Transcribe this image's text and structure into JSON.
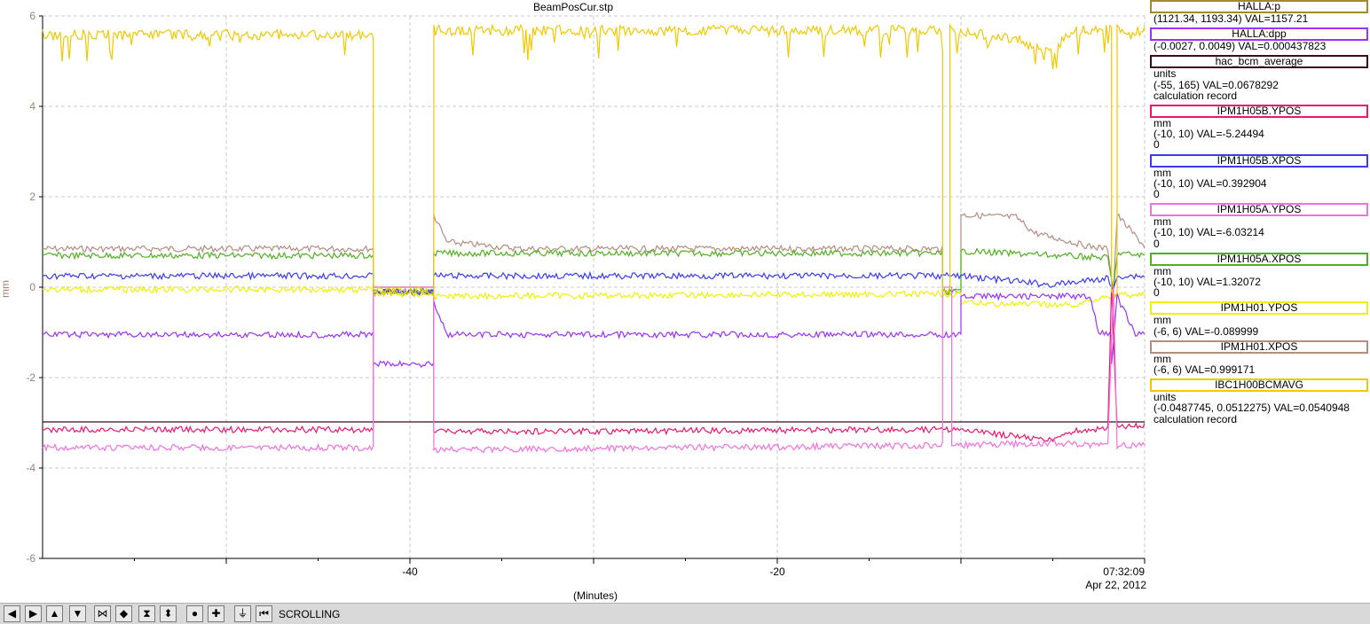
{
  "window": {
    "title": "BeamPosCur.stp"
  },
  "axis": {
    "ylabel": "mm",
    "xlabel": "(Minutes)",
    "timestamp_time": "07:32:09",
    "timestamp_date": "Apr 22, 2012",
    "y_ticks": [
      "6",
      "4",
      "2",
      "0",
      "-2",
      "-4",
      "-6"
    ],
    "x_ticks": [
      "-40",
      "-20"
    ]
  },
  "legend": [
    {
      "name": "HALLA:p",
      "color": "#a08c28",
      "lines": [
        "(1121.34, 1193.34) VAL=1157.21"
      ]
    },
    {
      "name": "HALLA:dpp",
      "color": "#9b30ff",
      "lines": [
        "(-0.0027, 0.0049) VAL=0.000437823"
      ]
    },
    {
      "name": "hac_bcm_average",
      "color": "#3a0a1e",
      "lines": [
        "units",
        "(-55, 165) VAL=0.0678292",
        "calculation record"
      ]
    },
    {
      "name": "IPM1H05B.YPOS",
      "color": "#e8186e",
      "lines": [
        "mm",
        "(-10, 10) VAL=-5.24494",
        "0"
      ]
    },
    {
      "name": "IPM1H05B.XPOS",
      "color": "#3a3af0",
      "lines": [
        "mm",
        "(-10, 10) VAL=0.392904",
        "0"
      ]
    },
    {
      "name": "IPM1H05A.YPOS",
      "color": "#f070e0",
      "lines": [
        "mm",
        "(-10, 10) VAL=-6.03214",
        "0"
      ]
    },
    {
      "name": "IPM1H05A.XPOS",
      "color": "#50b020",
      "lines": [
        "mm",
        "(-10, 10) VAL=1.32072",
        "0"
      ]
    },
    {
      "name": "IPM1H01.YPOS",
      "color": "#f0f000",
      "lines": [
        "mm",
        "(-6, 6) VAL=-0.089999"
      ]
    },
    {
      "name": "IPM1H01.XPOS",
      "color": "#b48c80",
      "lines": [
        "mm",
        "(-6, 6) VAL=0.999171"
      ]
    },
    {
      "name": "IBC1H00BCMAVG",
      "color": "#f0c800",
      "lines": [
        "units",
        "(-0.0487745, 0.0512275) VAL=0.0540948",
        "calculation record"
      ]
    }
  ],
  "chart_data": {
    "type": "line",
    "xlabel": "(Minutes)",
    "ylabel": "mm",
    "xlim": [
      -60,
      0
    ],
    "ylim": [
      -6,
      6
    ],
    "grid": true,
    "legend_position": "right",
    "series": [
      {
        "name": "IPM1H01.XPOS",
        "color": "#b48c80",
        "points": [
          [
            -60,
            0.85
          ],
          [
            -42,
            0.85
          ],
          [
            -42,
            -0.1
          ],
          [
            -38.7,
            -0.1
          ],
          [
            -38.7,
            1.6
          ],
          [
            -38,
            1.0
          ],
          [
            -34,
            0.85
          ],
          [
            -11,
            0.85
          ],
          [
            -11,
            -0.1
          ],
          [
            -10,
            -0.1
          ],
          [
            -10,
            1.6
          ],
          [
            -7,
            1.55
          ],
          [
            -6,
            1.2
          ],
          [
            -3,
            0.9
          ],
          [
            -2,
            0.85
          ],
          [
            -1.7,
            -0.1
          ],
          [
            -1.5,
            1.6
          ],
          [
            0,
            0.9
          ]
        ]
      },
      {
        "name": "IPM1H05A.XPOS",
        "color": "#50b020",
        "points": [
          [
            -60,
            0.7
          ],
          [
            -42,
            0.7
          ],
          [
            -42,
            -0.1
          ],
          [
            -38.7,
            -0.1
          ],
          [
            -38.7,
            0.75
          ],
          [
            -11,
            0.75
          ],
          [
            -11,
            -0.1
          ],
          [
            -10,
            -0.1
          ],
          [
            -10,
            0.8
          ],
          [
            -2,
            0.65
          ],
          [
            -1.7,
            -0.1
          ],
          [
            -1.5,
            0.75
          ],
          [
            0,
            0.7
          ]
        ]
      },
      {
        "name": "IPM1H05B.XPOS",
        "color": "#3a3af0",
        "points": [
          [
            -60,
            0.25
          ],
          [
            -42,
            0.25
          ],
          [
            -42,
            -0.1
          ],
          [
            -38.7,
            -0.1
          ],
          [
            -38.7,
            0.25
          ],
          [
            -10,
            0.25
          ],
          [
            -5,
            0.05
          ],
          [
            -2,
            0.2
          ],
          [
            -1.7,
            -0.1
          ],
          [
            -1.5,
            0.25
          ],
          [
            0,
            0.25
          ]
        ]
      },
      {
        "name": "IPM1H01.YPOS",
        "color": "#f0f000",
        "points": [
          [
            -60,
            -0.05
          ],
          [
            -42,
            -0.05
          ],
          [
            -42,
            -0.15
          ],
          [
            -38.7,
            -0.15
          ],
          [
            -38.7,
            -0.2
          ],
          [
            -10,
            -0.15
          ],
          [
            -10,
            -0.35
          ],
          [
            -4,
            -0.4
          ],
          [
            -2,
            -0.2
          ],
          [
            0,
            -0.15
          ]
        ]
      },
      {
        "name": "HALLA:dpp",
        "color": "#9b30ff",
        "points": [
          [
            -60,
            -1.05
          ],
          [
            -42,
            -1.05
          ],
          [
            -42,
            -1.7
          ],
          [
            -38.7,
            -1.7
          ],
          [
            -38.7,
            -0.3
          ],
          [
            -38,
            -1.05
          ],
          [
            -11,
            -1.05
          ],
          [
            -10,
            -1.05
          ],
          [
            -10,
            -0.2
          ],
          [
            -3,
            -0.2
          ],
          [
            -2.5,
            -1.0
          ],
          [
            -1.8,
            -1.05
          ],
          [
            -1.8,
            -1.7
          ],
          [
            -1.5,
            -0.2
          ],
          [
            -0.5,
            -1.05
          ],
          [
            0,
            -1.05
          ]
        ]
      },
      {
        "name": "hac_bcm_average",
        "color": "#3a0a1e",
        "points": [
          [
            -60,
            -2.98
          ],
          [
            0,
            -2.98
          ]
        ]
      },
      {
        "name": "IPM1H05B.YPOS",
        "color": "#e8186e",
        "points": [
          [
            -60,
            -3.15
          ],
          [
            -42,
            -3.15
          ],
          [
            -42,
            0
          ],
          [
            -38.7,
            0
          ],
          [
            -38.7,
            -3.2
          ],
          [
            -10,
            -3.15
          ],
          [
            -5,
            -3.4
          ],
          [
            -4,
            -3.2
          ],
          [
            -2,
            -3.1
          ],
          [
            -1.8,
            0
          ],
          [
            -1.5,
            -3.1
          ],
          [
            0,
            -3.05
          ]
        ]
      },
      {
        "name": "IPM1H05A.YPOS",
        "color": "#f070e0",
        "points": [
          [
            -60,
            -3.55
          ],
          [
            -42,
            -3.55
          ],
          [
            -42,
            0
          ],
          [
            -38.7,
            0
          ],
          [
            -38.7,
            -3.6
          ],
          [
            -11,
            -3.5
          ],
          [
            -11,
            0
          ],
          [
            -10.5,
            0
          ],
          [
            -10.5,
            -3.5
          ],
          [
            -5,
            -3.45
          ],
          [
            -2,
            -3.5
          ],
          [
            -1.7,
            0
          ],
          [
            -1.5,
            -3.5
          ],
          [
            0,
            -3.5
          ]
        ]
      },
      {
        "name": "IBC1H00BCMAVG",
        "color": "#f0c800",
        "points": [
          [
            -60,
            5.7
          ],
          [
            -42,
            5.7
          ],
          [
            -42,
            -0.1
          ],
          [
            -38.7,
            -0.1
          ],
          [
            -38.7,
            5.8
          ],
          [
            -11,
            5.8
          ],
          [
            -11,
            -0.1
          ],
          [
            -10.6,
            -0.1
          ],
          [
            -10.6,
            5.8
          ],
          [
            -7,
            5.6
          ],
          [
            -5,
            5.3
          ],
          [
            -4,
            5.8
          ],
          [
            -1.8,
            5.8
          ],
          [
            -1.8,
            -0.1
          ],
          [
            -1.5,
            -0.1
          ],
          [
            -1.5,
            5.8
          ],
          [
            0,
            5.8
          ]
        ]
      }
    ]
  },
  "toolbar": {
    "mode_label": "SCROLLING",
    "buttons": [
      {
        "name": "scroll-left-button",
        "glyph": "◀"
      },
      {
        "name": "scroll-right-button",
        "glyph": "▶"
      },
      {
        "name": "scroll-up-button",
        "glyph": "▲"
      },
      {
        "name": "scroll-down-button",
        "glyph": "▼"
      },
      {
        "name": "zoom-in-x-button",
        "glyph": "⋈"
      },
      {
        "name": "zoom-out-x-button",
        "glyph": "◆"
      },
      {
        "name": "zoom-in-y-button",
        "glyph": "⧗"
      },
      {
        "name": "zoom-out-y-button",
        "glyph": "⬍"
      },
      {
        "name": "reset-button",
        "glyph": "●"
      },
      {
        "name": "add-button",
        "glyph": "✚"
      },
      {
        "name": "autoscale-button",
        "glyph": "⏚"
      },
      {
        "name": "scroll-mode-button",
        "glyph": "⏮"
      }
    ]
  }
}
